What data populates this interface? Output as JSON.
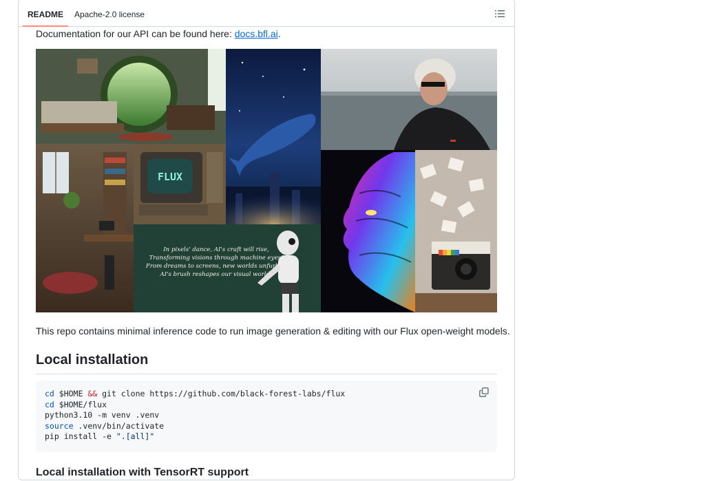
{
  "tabs": {
    "readme": "README",
    "license": "Apache-2.0 license"
  },
  "outline_icon": "list-unordered-icon",
  "doc": {
    "prefix": "Documentation for our API can be found here: ",
    "link_text": "docs.bfl.ai",
    "suffix": "."
  },
  "collage": {
    "flux_screen_text": "FLUX",
    "poem_lines": [
      "In pixels' dance, AI's craft will rise,",
      "Transforming visions through machine eyes!",
      "From dreams to screens, new worlds unfurled,",
      "AI's brush reshapes our visual world!"
    ]
  },
  "description": "This repo contains minimal inference code to run image generation & editing with our Flux open-weight models.",
  "local_install": {
    "heading": "Local installation",
    "code": {
      "l1_cmd": "cd",
      "l1_arg": " $HOME ",
      "l1_op": "&&",
      "l1_rest": " git clone https://github.com/black-forest-labs/flux",
      "l2_cmd": "cd",
      "l2_arg": " $HOME/flux",
      "l3": "python3.10 -m venv .venv",
      "l4_cmd": "source",
      "l4_arg": " .venv/bin/activate",
      "l5_pre": "pip install -e ",
      "l5_str": "\".[all]\""
    },
    "copy_icon": "copy-icon"
  },
  "next_heading": "Local installation with TensorRT support"
}
